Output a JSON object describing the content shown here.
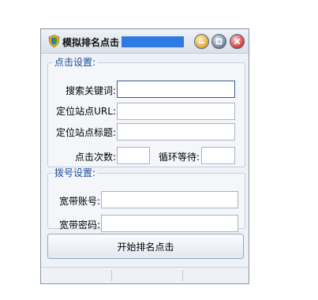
{
  "window": {
    "title": "模拟排名点击",
    "app_icon": "shield-icon",
    "controls": {
      "minimize": "minimize-icon",
      "maximize": "maximize-icon",
      "close": "close-icon"
    }
  },
  "click_settings": {
    "legend": "点击设置:",
    "keyword_label": "搜索关键词:",
    "keyword_value": "",
    "site_url_label": "定位站点URL:",
    "site_url_value": "",
    "site_title_label": "定位站点标题:",
    "site_title_value": "",
    "click_count_label": "点击次数:",
    "click_count_value": "",
    "loop_wait_label": "循环等待:",
    "loop_wait_value": ""
  },
  "dial_settings": {
    "legend": "拨号设置:",
    "account_label": "宽带账号:",
    "account_value": "",
    "password_label": "宽带密码:",
    "password_value": ""
  },
  "actions": {
    "start_label": "开始排名点击"
  },
  "colors": {
    "title_highlight": "#2f7ae0",
    "legend": "#1e4c9a"
  }
}
